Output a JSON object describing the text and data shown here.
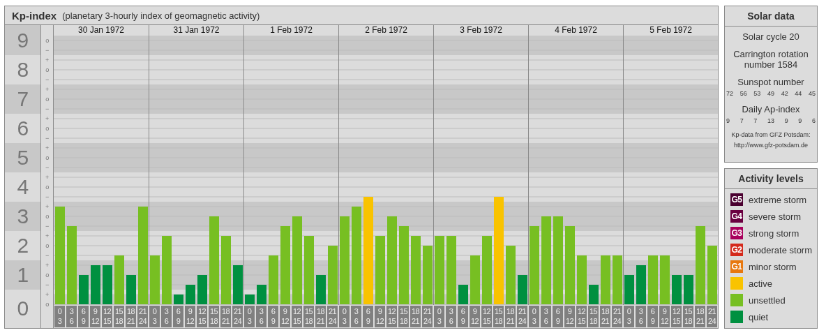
{
  "kp_panel": {
    "title": "Kp-index",
    "subtitle": "(planetary 3-hourly index of geomagnetic activity)",
    "dates": [
      "30 Jan 1972",
      "31 Jan 1972",
      "1 Feb 1972",
      "2 Feb 1972",
      "3 Feb 1972",
      "4 Feb 1972",
      "5 Feb 1972"
    ],
    "scale_marks": [
      "o",
      "−",
      "+",
      "o",
      "−",
      "+",
      "o",
      "−",
      "+",
      "o",
      "−",
      "+",
      "o",
      "−",
      "+",
      "o",
      "−",
      "+",
      "o",
      "−",
      "+",
      "o",
      "−",
      "+",
      "o",
      "−",
      "+",
      "o"
    ],
    "chart_data": {
      "type": "bar",
      "ylim": [
        0,
        9
      ],
      "grid": true,
      "yticks": [
        {
          "value": 9,
          "label": "9"
        },
        {
          "value": 8,
          "label": "8"
        },
        {
          "value": 7,
          "label": "7"
        },
        {
          "value": 6,
          "label": "6"
        },
        {
          "value": 5,
          "label": "5"
        },
        {
          "value": 4,
          "label": "4"
        },
        {
          "value": 3,
          "label": "3"
        },
        {
          "value": 2,
          "label": "2"
        },
        {
          "value": 1,
          "label": "1"
        },
        {
          "value": 0,
          "label": "0"
        }
      ],
      "categories": [
        "0\n3",
        "3\n6",
        "6\n9",
        "9\n12",
        "12\n15",
        "15\n18",
        "18\n21",
        "21\n24",
        "0\n3",
        "3\n6",
        "6\n9",
        "9\n12",
        "12\n15",
        "15\n18",
        "18\n21",
        "21\n24",
        "0\n3",
        "3\n6",
        "6\n9",
        "9\n12",
        "12\n15",
        "15\n18",
        "18\n21",
        "21\n24",
        "0\n3",
        "3\n6",
        "6\n9",
        "9\n12",
        "12\n15",
        "15\n18",
        "18\n21",
        "21\n24",
        "0\n3",
        "3\n6",
        "6\n9",
        "9\n12",
        "12\n15",
        "15\n18",
        "18\n21",
        "21\n24",
        "0\n3",
        "3\n6",
        "6\n9",
        "9\n12",
        "12\n15",
        "15\n18",
        "18\n21",
        "21\n24",
        "0\n3",
        "3\n6",
        "6\n9",
        "9\n12",
        "12\n15",
        "15\n18",
        "18\n21",
        "21\n24"
      ],
      "series": [
        {
          "values": [
            3.33,
            2.67,
            1,
            1.33,
            1.33,
            1.67,
            1,
            3.33,
            1.67,
            2.33,
            0.33,
            0.67,
            1,
            3,
            2.33,
            1.33,
            0.33,
            0.67,
            1.67,
            2.67,
            3,
            2.33,
            1,
            2,
            3,
            3.33,
            3.67,
            2.33,
            3,
            2.67,
            2.33,
            2,
            2.33,
            2.33,
            0.67,
            1.67,
            2.33,
            3.67,
            2,
            1,
            2.67,
            3,
            3,
            2.67,
            1.67,
            0.67,
            1.67,
            1.67,
            1,
            1.33,
            1.67,
            1.67,
            1,
            1,
            2.67,
            2
          ]
        }
      ]
    }
  },
  "solar_data": {
    "title": "Solar data",
    "cycle": "Solar cycle 20",
    "rotation": "Carrington rotation number 1584",
    "sunspot_label": "Sunspot number",
    "sunspot_numbers": [
      "72",
      "56",
      "53",
      "49",
      "42",
      "44",
      "45"
    ],
    "ap_label": "Daily Ap-index",
    "ap_values": [
      "9",
      "7",
      "7",
      "13",
      "9",
      "9",
      "6"
    ],
    "source": "Kp-data from GFZ Potsdam:",
    "source_url": "http://www.gfz-potsdam.de"
  },
  "activity_levels": {
    "title": "Activity levels",
    "items": [
      {
        "badge": "G5",
        "label": "extreme storm",
        "color": "#4a0030"
      },
      {
        "badge": "G4",
        "label": "severe storm",
        "color": "#6a0040"
      },
      {
        "badge": "G3",
        "label": "strong storm",
        "color": "#a8005c"
      },
      {
        "badge": "G2",
        "label": "moderate storm",
        "color": "#d42a1c"
      },
      {
        "badge": "G1",
        "label": "minor storm",
        "color": "#e8780e"
      },
      {
        "label": "active",
        "color": "#f9c300"
      },
      {
        "label": "unsettled",
        "color": "#77bf22"
      },
      {
        "label": "quiet",
        "color": "#009040"
      }
    ]
  }
}
